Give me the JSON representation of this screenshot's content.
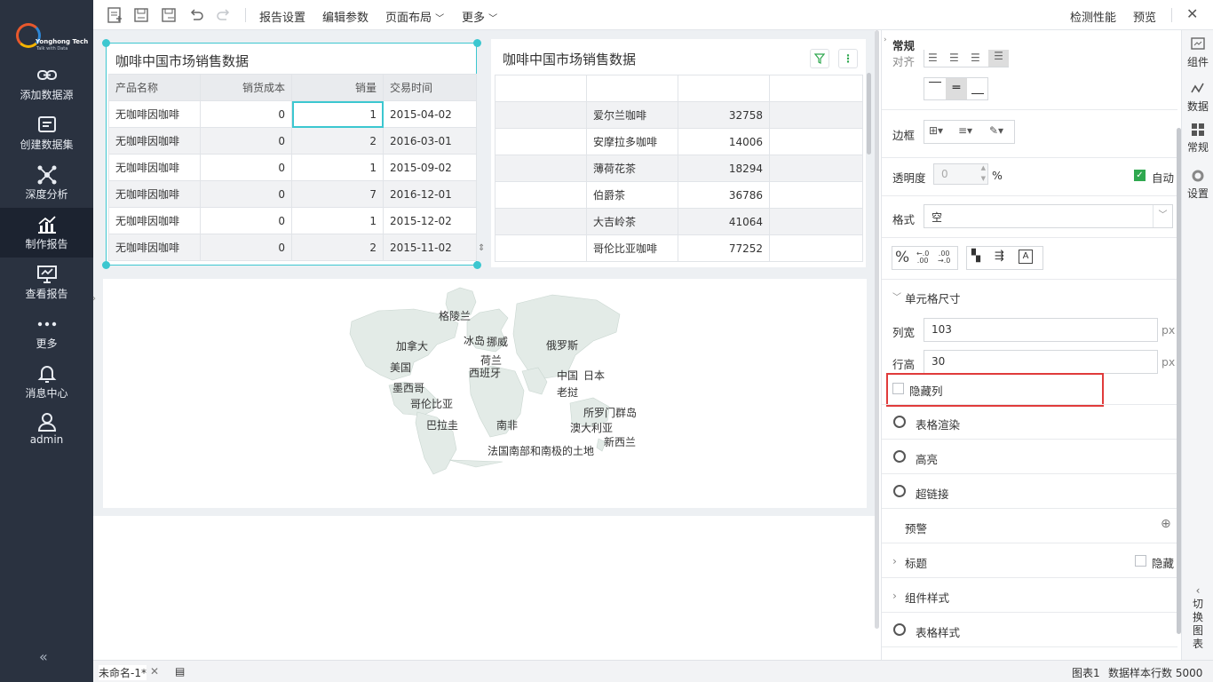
{
  "app": {
    "brand": "Yonghong Tech",
    "tagline": "Talk with Data"
  },
  "nav": {
    "items": [
      {
        "label": "添加数据源",
        "icon": "link-icon"
      },
      {
        "label": "创建数据集",
        "icon": "dataset-icon"
      },
      {
        "label": "深度分析",
        "icon": "network-icon"
      },
      {
        "label": "制作报告",
        "icon": "report-chart-icon",
        "active": true
      },
      {
        "label": "查看报告",
        "icon": "presentation-icon"
      },
      {
        "label": "更多",
        "icon": "more-dots-icon"
      },
      {
        "label": "消息中心",
        "icon": "bell-icon"
      },
      {
        "label": "admin",
        "icon": "user-icon"
      }
    ],
    "collapse": "«"
  },
  "toolbar": {
    "report_settings": "报告设置",
    "edit_params": "编辑参数",
    "page_layout": "页面布局",
    "more": "更多",
    "check_perf": "检测性能",
    "preview": "预览",
    "close": "✕"
  },
  "table1": {
    "title": "咖啡中国市场销售数据",
    "headers": [
      "产品名称",
      "销货成本",
      "销量",
      "交易时间"
    ],
    "rows": [
      [
        "无咖啡因咖啡",
        "0",
        "1",
        "2015-04-02"
      ],
      [
        "无咖啡因咖啡",
        "0",
        "2",
        "2016-03-01"
      ],
      [
        "无咖啡因咖啡",
        "0",
        "1",
        "2015-09-02"
      ],
      [
        "无咖啡因咖啡",
        "0",
        "7",
        "2016-12-01"
      ],
      [
        "无咖啡因咖啡",
        "0",
        "1",
        "2015-12-02"
      ],
      [
        "无咖啡因咖啡",
        "0",
        "2",
        "2015-11-02"
      ]
    ]
  },
  "table2": {
    "title": "咖啡中国市场销售数据",
    "rows": [
      [
        "",
        "爱尔兰咖啡",
        "32758",
        ""
      ],
      [
        "",
        "安摩拉多咖啡",
        "14006",
        ""
      ],
      [
        "",
        "薄荷花茶",
        "18294",
        ""
      ],
      [
        "",
        "伯爵茶",
        "36786",
        ""
      ],
      [
        "",
        "大吉岭茶",
        "41064",
        ""
      ],
      [
        "",
        "哥伦比亚咖啡",
        "77252",
        ""
      ]
    ]
  },
  "map": {
    "labels": [
      "格陵兰",
      "加拿大",
      "冰岛",
      "挪威",
      "俄罗斯",
      "荷兰",
      "西班牙",
      "美国",
      "中国",
      "日本",
      "墨西哥",
      "老挝",
      "哥伦比亚",
      "所罗门群岛",
      "巴拉圭",
      "南非",
      "澳大利亚",
      "新西兰",
      "法国南部和南极的土地"
    ]
  },
  "props": {
    "section": "常规",
    "align_label": "对齐",
    "border_label": "边框",
    "opacity_label": "透明度",
    "opacity_value": "0",
    "opacity_unit": "%",
    "auto_label": "自动",
    "format_label": "格式",
    "format_value": "空",
    "cell_size_label": "单元格尺寸",
    "col_width_label": "列宽",
    "col_width_value": "103",
    "row_height_label": "行高",
    "row_height_value": "30",
    "px": "px",
    "hide_col_label": "隐藏列",
    "table_render": "表格渲染",
    "highlight": "高亮",
    "hyperlink": "超链接",
    "alert": "预警",
    "title_label": "标题",
    "hide_label": "隐藏",
    "component_style": "组件样式",
    "table_style": "表格样式"
  },
  "righttabs": [
    {
      "label": "组件",
      "icon": "component-icon"
    },
    {
      "label": "数据",
      "icon": "data-icon"
    },
    {
      "label": "常规",
      "icon": "general-icon"
    },
    {
      "label": "设置",
      "icon": "settings-icon"
    }
  ],
  "switch_chart": [
    "切",
    "换",
    "图",
    "表"
  ],
  "status": {
    "tab_name": "未命名-1*",
    "chart_name": "图表1",
    "sample_rows": "数据样本行数 5000"
  },
  "colors": {
    "nav_bg": "#2a3240",
    "accent": "#3cc7d0",
    "highlight_red": "#e03b3b",
    "check_green": "#2fa84f"
  }
}
